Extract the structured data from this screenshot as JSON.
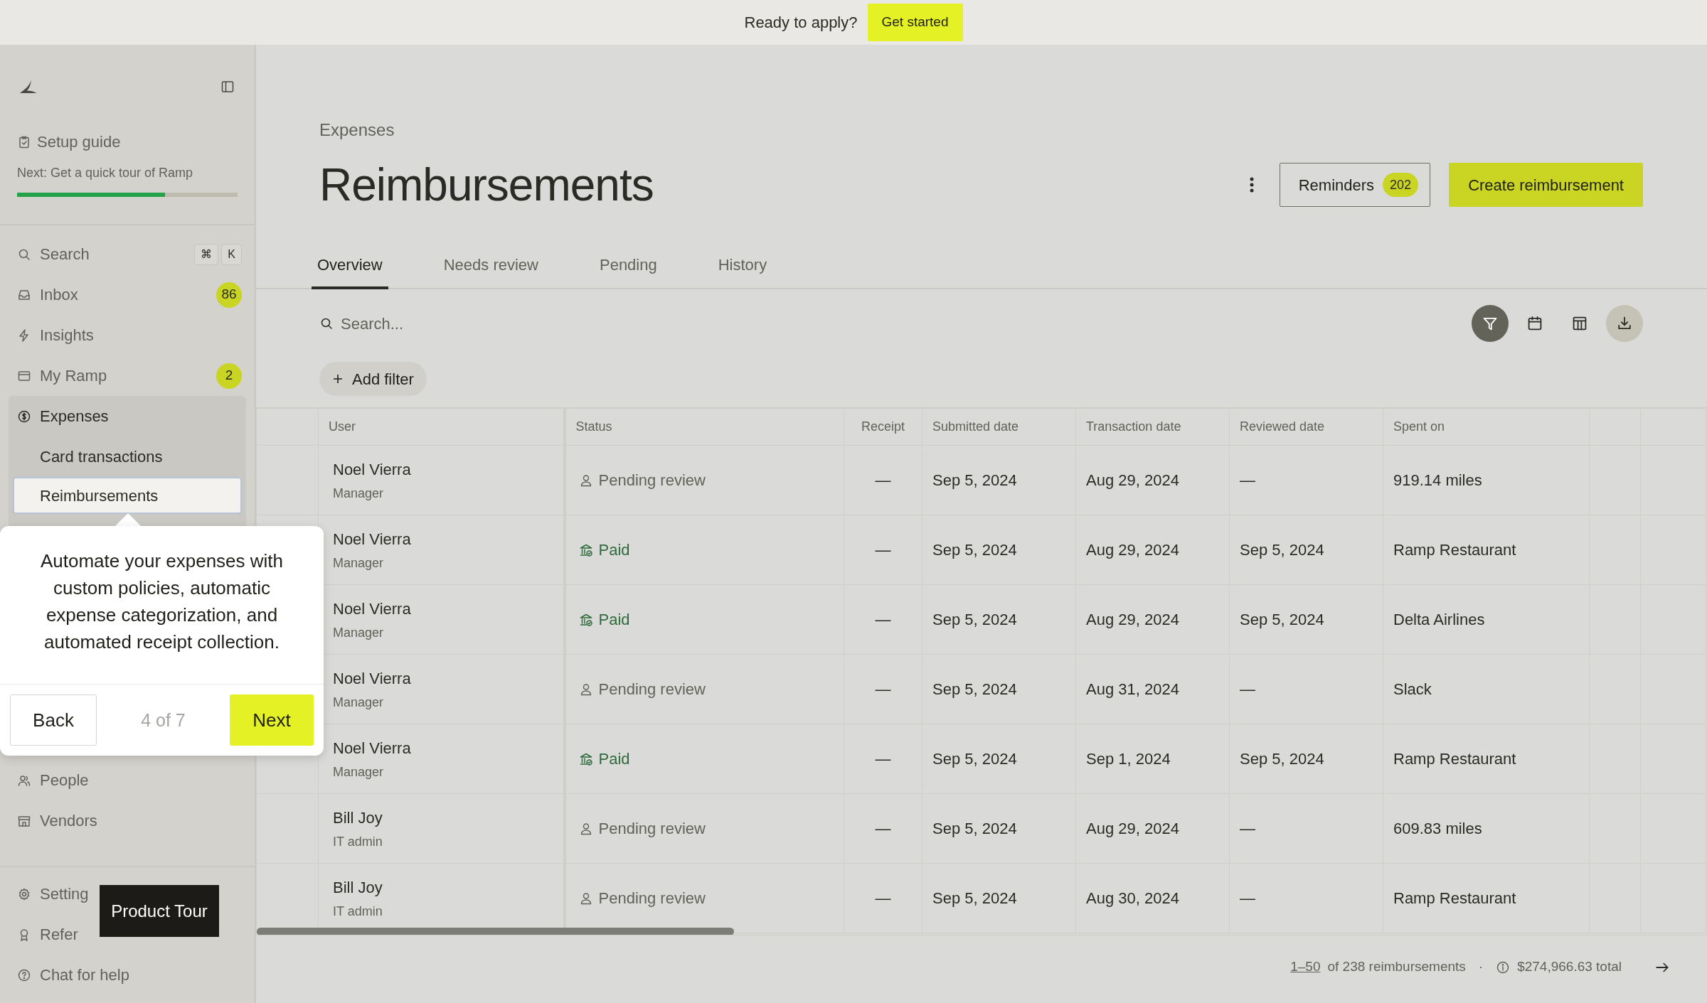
{
  "banner": {
    "text": "Ready to apply?",
    "button": "Get started"
  },
  "sidebar": {
    "setup": {
      "title": "Setup guide",
      "next": "Next: Get a quick tour of Ramp",
      "level": 0.67
    },
    "nav": [
      {
        "label": "Search",
        "keys": [
          "⌘",
          "K"
        ],
        "selected": false
      },
      {
        "label": "Inbox",
        "badge": "86",
        "selected": false
      },
      {
        "label": "Insights",
        "selected": false
      },
      {
        "label": "My Ramp",
        "badge": "2",
        "selected": false
      },
      {
        "label": "Expenses",
        "selected": true,
        "children": [
          {
            "label": "Card transactions",
            "selected": false
          },
          {
            "label": "Reimbursements",
            "selected": true
          }
        ]
      }
    ],
    "more": [
      {
        "label": "People",
        "selected": false
      },
      {
        "label": "Vendors",
        "selected": false
      }
    ],
    "bottom": [
      {
        "label": "Setting",
        "selected": false
      },
      {
        "label": "Refer",
        "selected": false
      },
      {
        "label": "Chat for help",
        "selected": false
      }
    ]
  },
  "tour": {
    "text": "Automate your expenses with custom policies, automatic expense categorization, and automated receipt collection.",
    "back": "Back",
    "counter": "4 of 7",
    "next": "Next",
    "label": "Product Tour"
  },
  "header": {
    "breadcrumb": "Expenses",
    "title": "Reimbursements",
    "reminders": {
      "label": "Reminders",
      "badge": "202"
    },
    "create": "Create reimbursement"
  },
  "tabs": [
    {
      "label": "Overview",
      "selected": true
    },
    {
      "label": "Needs review",
      "selected": false
    },
    {
      "label": "Pending",
      "selected": false
    },
    {
      "label": "History",
      "selected": false
    }
  ],
  "search": {
    "placeholder": "Search..."
  },
  "toolbar": [
    {
      "active": true
    },
    {
      "active": false
    },
    {
      "active": false
    },
    {
      "active": false
    }
  ],
  "add_filter": "Add filter",
  "table": {
    "columns": [
      "User",
      "Status",
      "Receipt",
      "Submitted date",
      "Transaction date",
      "Reviewed date",
      "Spent on"
    ],
    "rows": [
      {
        "user": "Noel Vierra",
        "role": "Manager",
        "status": {
          "kind": "pending",
          "label": "Pending review"
        },
        "receipt": "—",
        "submitted": "Sep 5, 2024",
        "transaction": "Aug 29, 2024",
        "reviewed": "—",
        "spent_on": "919.14 miles"
      },
      {
        "user": "Noel Vierra",
        "role": "Manager",
        "status": {
          "kind": "paid",
          "label": "Paid"
        },
        "receipt": "—",
        "submitted": "Sep 5, 2024",
        "transaction": "Aug 29, 2024",
        "reviewed": "Sep 5, 2024",
        "spent_on": "Ramp Restaurant"
      },
      {
        "user": "Noel Vierra",
        "role": "Manager",
        "status": {
          "kind": "paid",
          "label": "Paid"
        },
        "receipt": "—",
        "submitted": "Sep 5, 2024",
        "transaction": "Aug 29, 2024",
        "reviewed": "Sep 5, 2024",
        "spent_on": "Delta Airlines"
      },
      {
        "user": "Noel Vierra",
        "role": "Manager",
        "status": {
          "kind": "pending",
          "label": "Pending review"
        },
        "receipt": "—",
        "submitted": "Sep 5, 2024",
        "transaction": "Aug 31, 2024",
        "reviewed": "—",
        "spent_on": "Slack"
      },
      {
        "user": "Noel Vierra",
        "role": "Manager",
        "status": {
          "kind": "paid",
          "label": "Paid"
        },
        "receipt": "—",
        "submitted": "Sep 5, 2024",
        "transaction": "Sep 1, 2024",
        "reviewed": "Sep 5, 2024",
        "spent_on": "Ramp Restaurant"
      },
      {
        "user": "Bill Joy",
        "role": "IT admin",
        "status": {
          "kind": "pending",
          "label": "Pending review"
        },
        "receipt": "—",
        "submitted": "Sep 5, 2024",
        "transaction": "Aug 29, 2024",
        "reviewed": "—",
        "spent_on": "609.83 miles"
      },
      {
        "user": "Bill Joy",
        "role": "IT admin",
        "status": {
          "kind": "pending",
          "label": "Pending review"
        },
        "receipt": "—",
        "submitted": "Sep 5, 2024",
        "transaction": "Aug 30, 2024",
        "reviewed": "—",
        "spent_on": "Ramp Restaurant"
      }
    ]
  },
  "footer": {
    "range": "1–50",
    "count": "of 238 reimbursements",
    "separator": "·",
    "total": "$274,966.63 total"
  }
}
